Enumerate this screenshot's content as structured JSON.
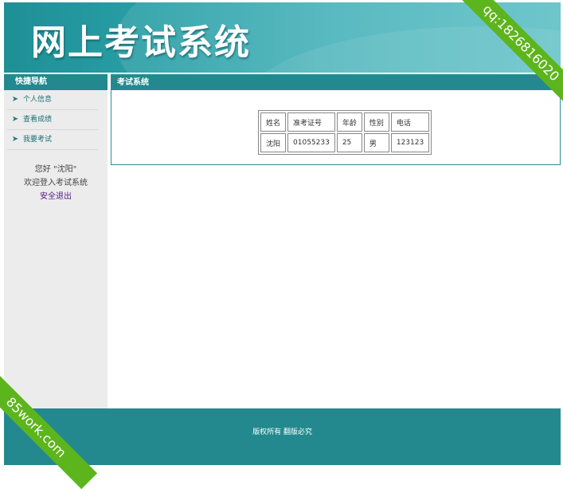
{
  "header": {
    "title": "网上考试系统"
  },
  "sidebar": {
    "title": "快捷导航",
    "items": [
      {
        "label": "个人信息"
      },
      {
        "label": "查看成绩"
      },
      {
        "label": "我要考试"
      }
    ],
    "greeting": "您好 \"沈阳\"",
    "welcome": "欢迎登入考试系统",
    "logout": "安全退出"
  },
  "content": {
    "title": "考试系统",
    "table": {
      "headers": [
        "姓名",
        "准考证号",
        "年龄",
        "性别",
        "电话"
      ],
      "row": [
        "沈阳",
        "01055233",
        "25",
        "男",
        "123123"
      ]
    }
  },
  "footer": {
    "text": "版权所有 翻版必究"
  },
  "watermarks": {
    "top_right": "qq:1826816020",
    "bottom_left": "85work.com"
  },
  "colors": {
    "accent": "#23898f",
    "ribbon": "#5db51d"
  }
}
